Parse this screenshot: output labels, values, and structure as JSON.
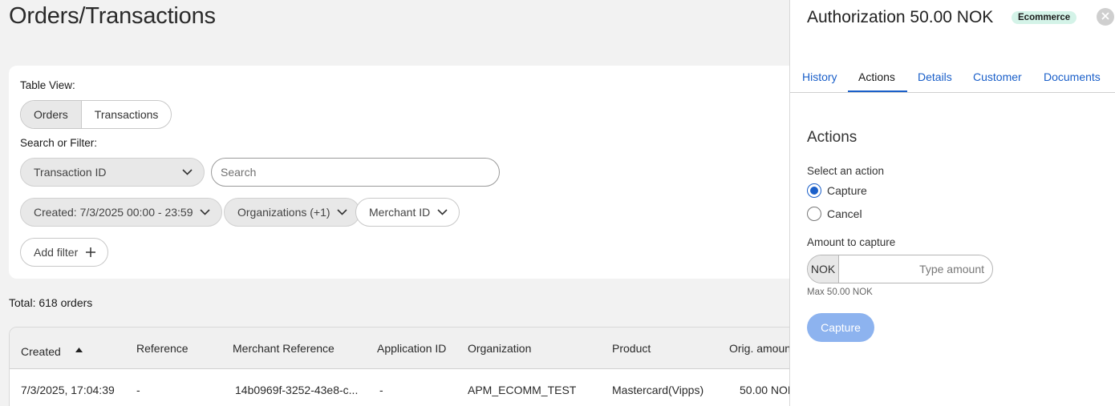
{
  "page": {
    "title": "Orders/Transactions"
  },
  "filters": {
    "table_view_label": "Table View:",
    "segments": [
      "Orders",
      "Transactions"
    ],
    "search_label": "Search or Filter:",
    "field_select": "Transaction ID",
    "search_placeholder": "Search",
    "created_filter": "Created: 7/3/2025 00:00 - 23:59",
    "org_filter": "Organizations (+1)",
    "merchant_filter": "Merchant ID",
    "add_filter": "Add filter"
  },
  "summary": {
    "total": "Total: 618 orders"
  },
  "table": {
    "columns": [
      "Created",
      "Reference",
      "Merchant Reference",
      "Application ID",
      "Organization",
      "Product",
      "Orig. amoun"
    ],
    "rows": [
      [
        "7/3/2025, 17:04:39",
        "-",
        "14b0969f-3252-43e8-c...",
        "-",
        "APM_ECOMM_TEST",
        "Mastercard(Vipps)",
        "50.00 NOK"
      ]
    ]
  },
  "panel": {
    "title": "Authorization 50.00 NOK",
    "badge": "Ecommerce",
    "tabs": [
      "History",
      "Actions",
      "Details",
      "Customer",
      "Documents"
    ],
    "active_tab": "Actions",
    "section_title": "Actions",
    "select_label": "Select an action",
    "options": [
      "Capture",
      "Cancel"
    ],
    "selected_option": "Capture",
    "amount_label": "Amount to capture",
    "currency": "NOK",
    "amount_placeholder": "Type amount",
    "max_hint": "Max 50.00 NOK",
    "capture_button": "Capture"
  },
  "colors": {
    "accent": "#1a5fc9",
    "badge_bg": "#d4f3e8",
    "button_disabled": "#8db3ef"
  }
}
